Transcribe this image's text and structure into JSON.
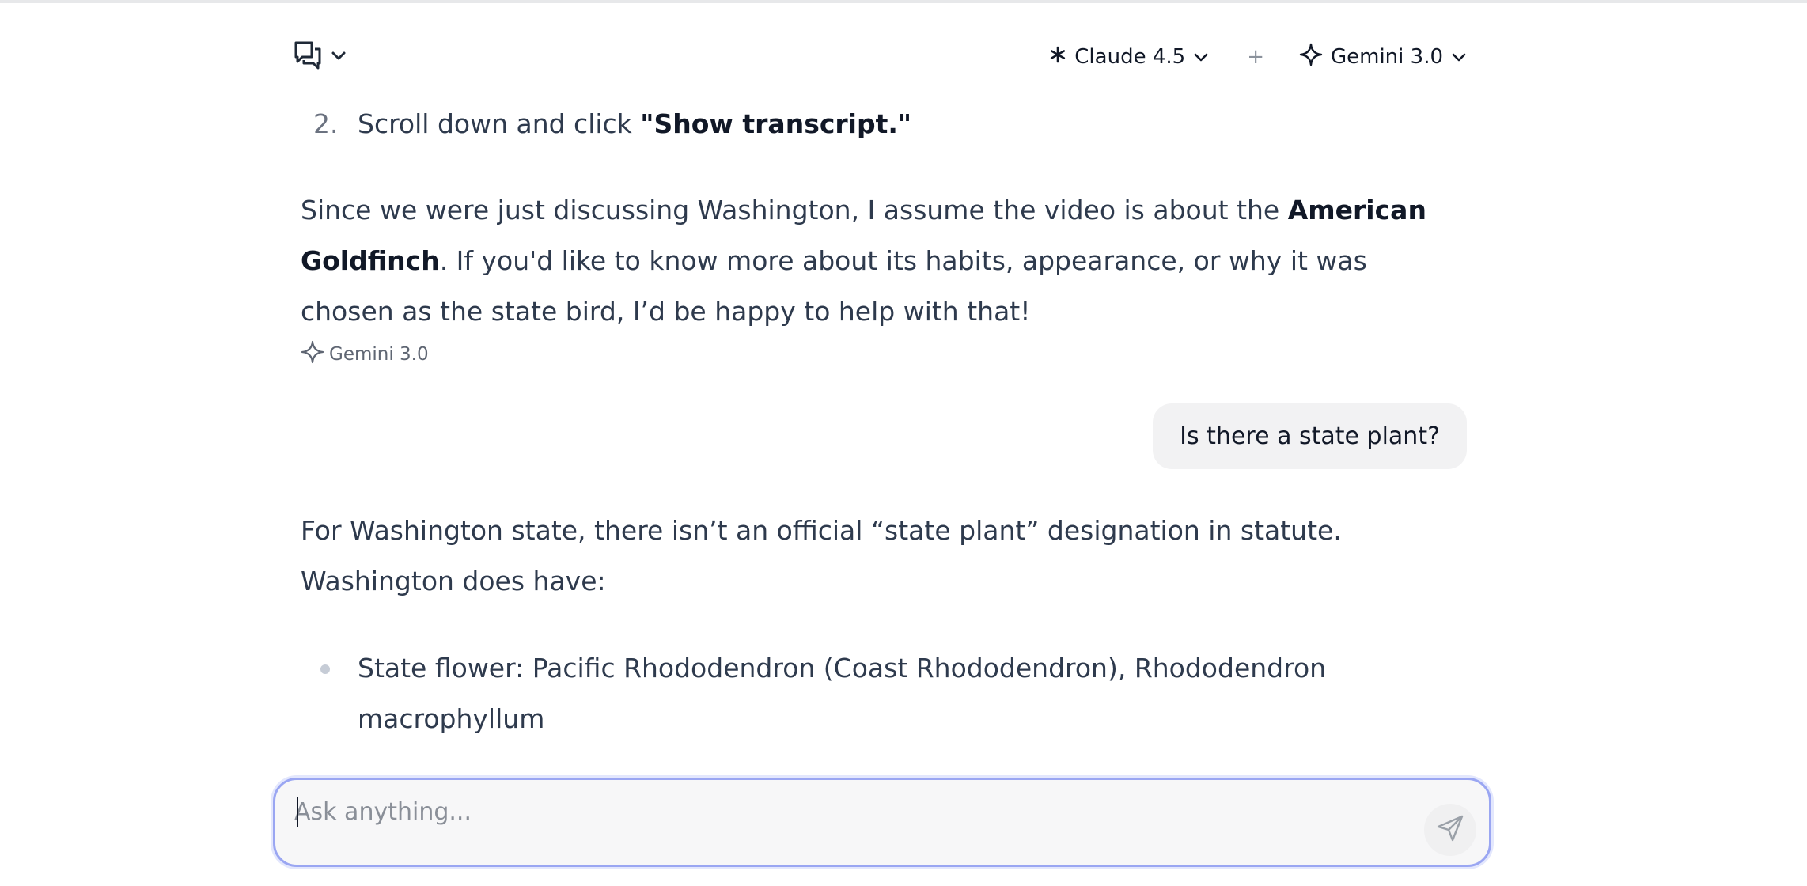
{
  "header": {
    "chat_switch_icon": "chat-bubbles-icon",
    "models": [
      {
        "icon": "asterisk-icon",
        "label": "Claude 4.5"
      },
      {
        "icon": "sparkle-icon",
        "label": "Gemini 3.0"
      }
    ],
    "separator": "+"
  },
  "conversation": {
    "step": {
      "number": "2.",
      "text": "Scroll down and click ",
      "bold": "\"Show transcript.\""
    },
    "para1": {
      "a": "Since we were just discussing Washington, I assume the video is about the ",
      "bold": "American Goldfinch",
      "b": ". If you'd like to know more about its habits, appearance, or why it was chosen as the state bird, I’d be happy to help with that!"
    },
    "attribution": {
      "icon": "sparkle-icon",
      "label": "Gemini 3.0"
    },
    "user_message": "Is there a state plant?",
    "para2": "For Washington state, there isn’t an official “state plant” designation in statute. Washington does have:",
    "bullets": [
      "State flower: Pacific Rhododendron (Coast Rhododendron), Rhododendron macrophyllum"
    ]
  },
  "composer": {
    "placeholder": "Ask anything...",
    "value": "",
    "send_icon": "send-icon"
  },
  "colors": {
    "accent_border": "#9aa6f2",
    "text": "#2e3a4d",
    "bubble": "#f2f2f3"
  }
}
